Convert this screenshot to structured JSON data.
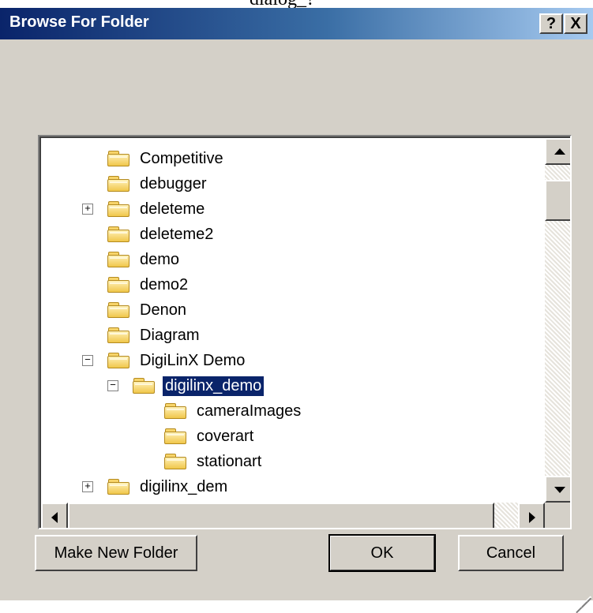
{
  "page_caption_fragment": "dialog_?",
  "window": {
    "title": "Browse For Folder",
    "help_glyph": "?",
    "close_glyph": "X"
  },
  "tree": {
    "items": [
      {
        "label": "Competitive",
        "expander": ""
      },
      {
        "label": "debugger",
        "expander": ""
      },
      {
        "label": "deleteme",
        "expander": "+"
      },
      {
        "label": "deleteme2",
        "expander": ""
      },
      {
        "label": "demo",
        "expander": ""
      },
      {
        "label": "demo2",
        "expander": ""
      },
      {
        "label": "Denon",
        "expander": ""
      },
      {
        "label": "Diagram",
        "expander": ""
      },
      {
        "label": "DigiLinX Demo",
        "expander": "−"
      },
      {
        "label": "digilinx_demo",
        "expander": "−",
        "selected": true
      },
      {
        "label": "cameraImages",
        "expander": ""
      },
      {
        "label": "coverart",
        "expander": ""
      },
      {
        "label": "stationart",
        "expander": ""
      },
      {
        "label": "digilinx_dem",
        "expander": "+"
      }
    ]
  },
  "buttons": {
    "make_new_folder": "Make New Folder",
    "ok": "OK",
    "cancel": "Cancel"
  },
  "icons": {
    "folder": "folder-icon",
    "scroll_up": "up-arrow-icon",
    "scroll_down": "down-arrow-icon",
    "scroll_left": "left-arrow-icon",
    "scroll_right": "right-arrow-icon",
    "resize_grip": "resize-grip-icon"
  },
  "colors": {
    "titlebar_start": "#0a246a",
    "titlebar_end": "#a6caf0",
    "dialog_face": "#d4d0c8",
    "selection": "#0a246a"
  }
}
